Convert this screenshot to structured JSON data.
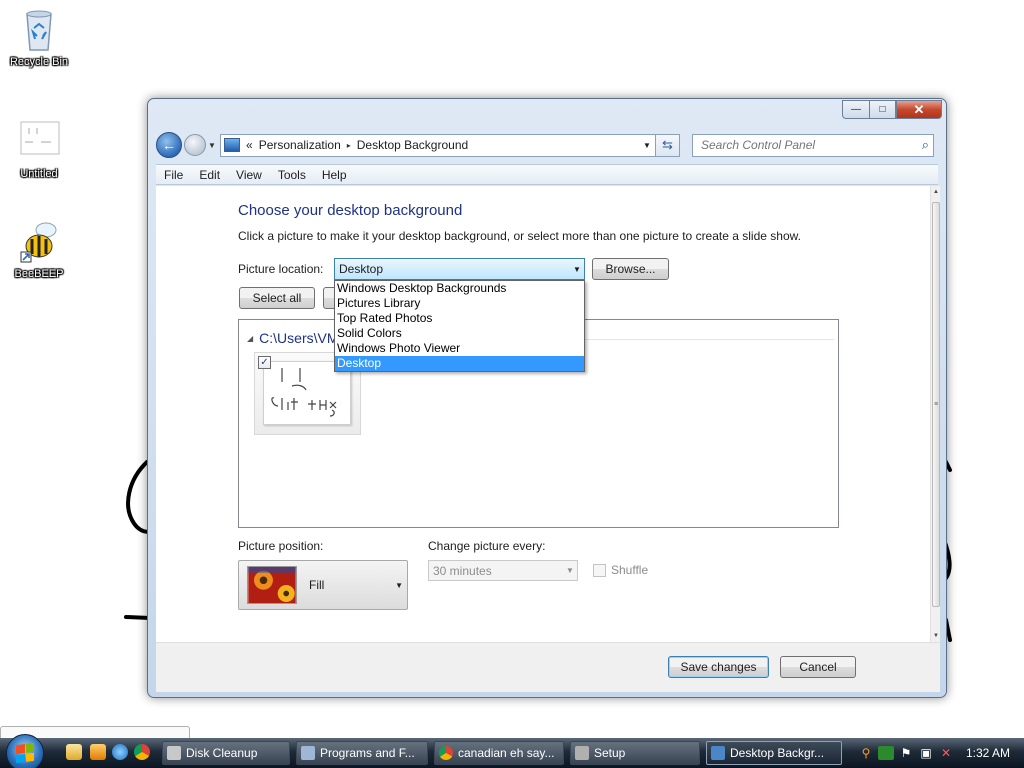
{
  "desktop": {
    "icons": [
      {
        "label": "Recycle Bin"
      },
      {
        "label": "Untitled"
      },
      {
        "label": "BeeBEEP"
      }
    ]
  },
  "window": {
    "controls": {
      "minimize": "—",
      "maximize": "□",
      "close": "✕"
    },
    "address": {
      "prefix": "«",
      "crumbs": [
        "Personalization",
        "Desktop Background"
      ],
      "separator": "▸"
    },
    "search_placeholder": "Search Control Panel",
    "menu": [
      "File",
      "Edit",
      "View",
      "Tools",
      "Help"
    ],
    "heading": "Choose your desktop background",
    "subtext": "Click a picture to make it your desktop background, or select more than one picture to create a slide show.",
    "picture_location_label": "Picture location:",
    "picture_location_value": "Desktop",
    "browse_label": "Browse...",
    "select_all_label": "Select all",
    "clear_all_label": "",
    "dropdown_options": [
      "Windows Desktop Backgrounds",
      "Pictures Library",
      "Top Rated Photos",
      "Solid Colors",
      "Windows Photo Viewer",
      "Desktop"
    ],
    "dropdown_selected_index": 5,
    "gallery_path": "C:\\Users\\VM",
    "thumbnail_checked": "✓",
    "picture_position_label": "Picture position:",
    "picture_position_value": "Fill",
    "change_picture_label": "Change picture every:",
    "change_picture_value": "30 minutes",
    "shuffle_label": "Shuffle",
    "save_label": "Save changes",
    "cancel_label": "Cancel"
  },
  "taskbar": {
    "buttons": [
      {
        "label": "Disk Cleanup",
        "icon_color": "#c8c8c8"
      },
      {
        "label": "Programs and F...",
        "icon_color": "#9fb7d6"
      },
      {
        "label": "canadian eh say...",
        "icon_color": "#e8b53a"
      },
      {
        "label": "Setup",
        "icon_color": "#b0b0b0"
      },
      {
        "label": "Desktop Backgr...",
        "icon_color": "#4a86c8",
        "active": true
      }
    ],
    "clock": "1:32 AM"
  },
  "colors": {
    "heading": "#1e3287",
    "selection": "#3399ff",
    "window_frame": "#c5d6ea"
  }
}
